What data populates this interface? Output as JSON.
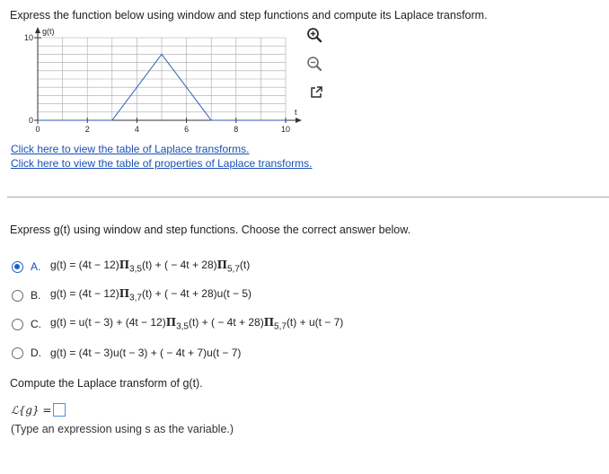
{
  "question": {
    "title": "Express the function below using window and step functions and compute its Laplace transform."
  },
  "graph": {
    "y_axis_label": "g(t)",
    "x_axis_label": "t",
    "y_ticks": [
      "10",
      "0"
    ],
    "x_ticks": [
      "0",
      "2",
      "4",
      "6",
      "8",
      "10"
    ]
  },
  "chart_data": {
    "type": "line",
    "x": [
      0,
      3,
      5,
      7,
      10
    ],
    "y": [
      0,
      0,
      8,
      0,
      0
    ],
    "xlabel": "t",
    "ylabel": "g(t)",
    "xlim": [
      0,
      10
    ],
    "ylim": [
      0,
      10
    ],
    "grid": true
  },
  "icons": {
    "zoom_in": "zoom-in-icon",
    "zoom_out": "zoom-out-icon",
    "popout": "external-link-icon"
  },
  "links": {
    "laplace_table": "Click here to view the table of Laplace transforms.",
    "properties_table": "Click here to view the table of properties of Laplace transforms."
  },
  "part1": {
    "prompt": "Express g(t) using window and step functions. Choose the correct answer below.",
    "selected": "A",
    "options": [
      {
        "letter": "A.",
        "text_a": "g(t) = (4t − 12)",
        "pi1": "Π",
        "sub1": "3,5",
        "text_b": "(t) + ( − 4t + 28)",
        "pi2": "Π",
        "sub2": "5,7",
        "text_c": "(t)"
      },
      {
        "letter": "B.",
        "text_a": "g(t) = (4t − 12)",
        "pi1": "Π",
        "sub1": "3,7",
        "text_b": "(t) + ( − 4t + 28)u(t − 5)"
      },
      {
        "letter": "C.",
        "text_a": "g(t) = u(t − 3) + (4t − 12)",
        "pi1": "Π",
        "sub1": "3,5",
        "text_b": "(t) + ( − 4t + 28)",
        "pi2": "Π",
        "sub2": "5,7",
        "text_c": "(t) + u(t − 7)"
      },
      {
        "letter": "D.",
        "text_a": "g(t) = (4t − 3)u(t − 3) + ( − 4t + 7)u(t − 7)"
      }
    ]
  },
  "part2": {
    "prompt": "Compute the Laplace transform of g(t).",
    "answer_prefix": "ℒ{g} =",
    "answer_value": "",
    "hint": "(Type an expression using s as the variable.)"
  },
  "colors": {
    "accent": "#1a5ec9",
    "link": "#1a4fb5",
    "input_border": "#4a90e2"
  }
}
